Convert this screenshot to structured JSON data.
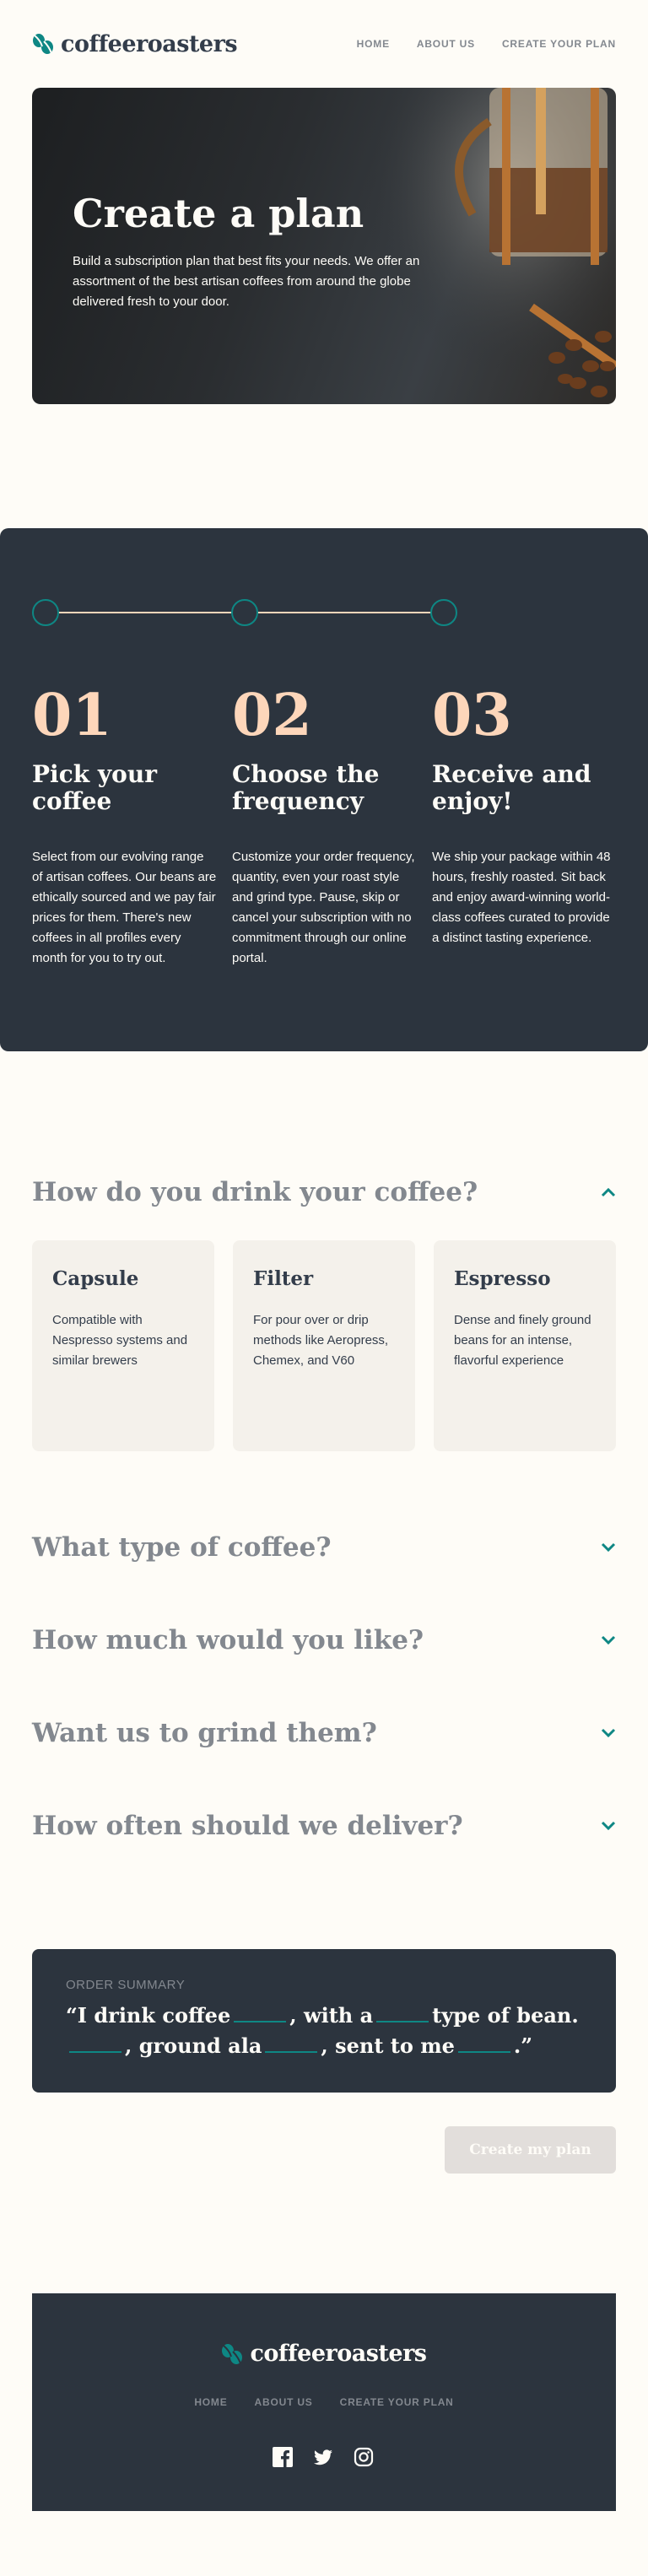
{
  "brand": {
    "name": "coffeeroasters",
    "accent": "#0e8784",
    "dark": "#2c343e",
    "peach": "#fdd6ba",
    "cream": "#fefcf7"
  },
  "nav": {
    "home": "HOME",
    "about": "ABOUT US",
    "plan": "CREATE YOUR PLAN"
  },
  "hero": {
    "title": "Create a plan",
    "description": "Build a subscription plan that best fits your needs. We offer an assortment of the best artisan coffees from around the globe delivered fresh to your door."
  },
  "steps": [
    {
      "num": "01",
      "title": "Pick your coffee",
      "text": "Select from our evolving range of artisan coffees. Our beans are ethically sourced and we pay fair prices for them. There's new coffees in all profiles every month for you to try out."
    },
    {
      "num": "02",
      "title": "Choose the frequency",
      "text": "Customize your order frequency, quantity, even your roast style and grind type. Pause, skip or cancel your subscription with no commitment through our online portal."
    },
    {
      "num": "03",
      "title": "Receive and enjoy!",
      "text": "We ship your package within 48 hours, freshly roasted. Sit back and enjoy award-winning world-class coffees curated to provide a distinct tasting experience."
    }
  ],
  "questions": {
    "q1": {
      "title": "How do you drink your coffee?",
      "expanded": true
    },
    "q2": {
      "title": "What type of coffee?"
    },
    "q3": {
      "title": "How much would you like?"
    },
    "q4": {
      "title": "Want us to grind them?"
    },
    "q5": {
      "title": "How often should we deliver?"
    }
  },
  "options": [
    {
      "title": "Capsule",
      "desc": "Compatible with Nespresso systems and similar brewers"
    },
    {
      "title": "Filter",
      "desc": "For pour over or drip methods like Aeropress, Chemex, and V60"
    },
    {
      "title": "Espresso",
      "desc": "Dense and finely ground beans for an intense, flavorful experience"
    }
  ],
  "summary": {
    "label": "ORDER SUMMARY",
    "p1": "“I drink coffee",
    "p2": ", with a",
    "p3": "type of bean.",
    "p4": ", ground ala",
    "p5": ", sent to me",
    "p6": ".”"
  },
  "cta": "Create my plan",
  "footer": {
    "home": "HOME",
    "about": "ABOUT US",
    "plan": "CREATE YOUR PLAN"
  },
  "icons": [
    "facebook-icon",
    "twitter-icon",
    "instagram-icon"
  ]
}
